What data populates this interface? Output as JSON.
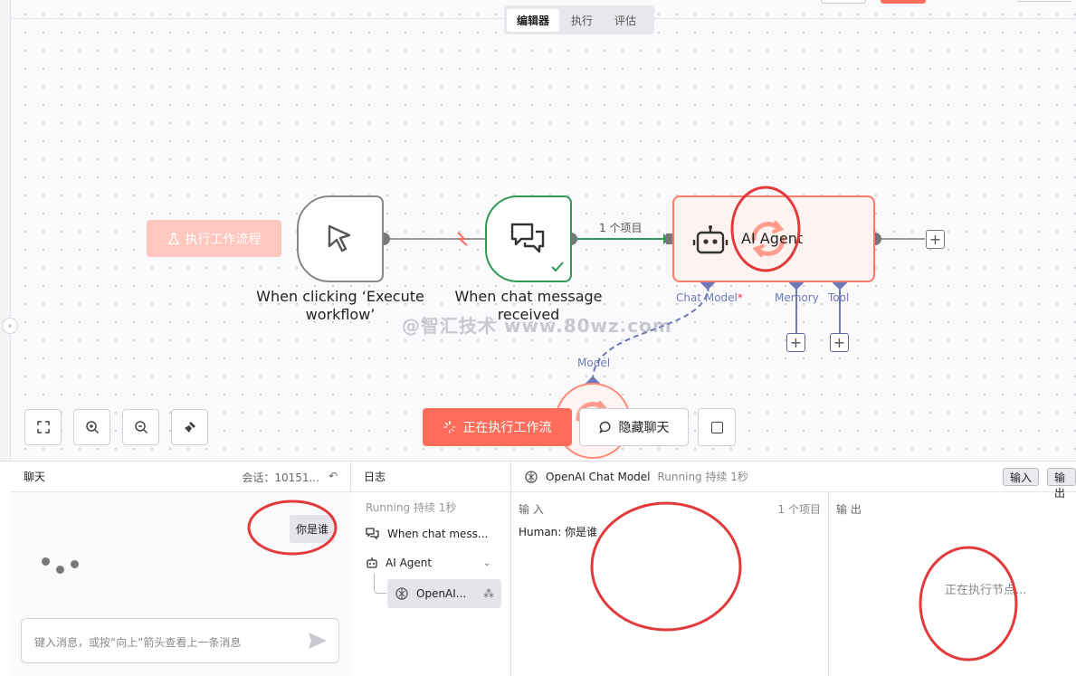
{
  "mode_tabs": [
    "编辑器",
    "执行",
    "评估"
  ],
  "canvas": {
    "exec_workflow_button": "执行工作流程",
    "nodes": {
      "trigger_label": "When clicking ‘Execute workflow’",
      "chat_trigger_label": "When chat message received",
      "agent_label": "AI Agent",
      "edge_items_label": "1 个项目",
      "chat_model_port": "Chat Model",
      "memory_port": "Memory",
      "tool_port": "Tool",
      "model_port": "Model"
    },
    "running_button": "正在执行工作流",
    "hide_chat_button": "隐藏聊天",
    "watermark": "@智汇技术 www.80wz.com"
  },
  "chat": {
    "title": "聊天",
    "session": "会话：10151...",
    "user_message": "你是谁",
    "input_placeholder": "键入消息，或按“向上”箭头查看上一条消息"
  },
  "logs": {
    "title": "日志",
    "status": "Running 持续 1秒",
    "items": [
      "When chat mess...",
      "AI Agent",
      "OpenAI..."
    ]
  },
  "detail": {
    "node_name": "OpenAI Chat Model",
    "status": "Running 持续 1秒",
    "input_btn": "输入",
    "output_btn": "输出",
    "input_heading": "输 入",
    "input_count": "1 个项目",
    "input_content": "Human: 你是谁",
    "output_heading": "输 出",
    "output_running": "正在执行节点..."
  },
  "colors": {
    "accent": "#ff6d5a",
    "success": "#2f9b57",
    "port": "#7079b8"
  }
}
